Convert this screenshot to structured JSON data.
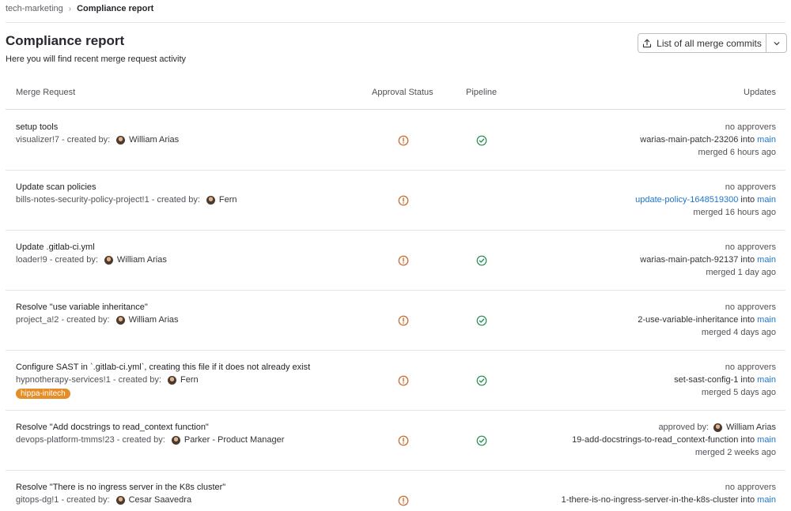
{
  "breadcrumb": {
    "group": "tech-marketing",
    "separator": "›",
    "current": "Compliance report"
  },
  "page": {
    "title": "Compliance report",
    "subtitle": "Here you will find recent merge request activity"
  },
  "export_button": {
    "label": "List of all merge commits",
    "icon": "export-icon",
    "caret_icon": "chevron-down-icon"
  },
  "table": {
    "headers": {
      "merge_request": "Merge Request",
      "approval_status": "Approval Status",
      "pipeline": "Pipeline",
      "updates": "Updates"
    },
    "rows": [
      {
        "title": "setup tools",
        "reference": "visualizer!7",
        "created_by_label": "- created by:",
        "author": "William Arias",
        "approval": "warning",
        "pipeline": "success",
        "approvers_text": "no approvers",
        "approver_name": "",
        "source_branch": "warias-main-patch-23206",
        "source_is_link": false,
        "into_label": "into",
        "target_branch": "main",
        "merged": "merged 6 hours ago",
        "label": ""
      },
      {
        "title": "Update scan policies",
        "reference": "bills-notes-security-policy-project!1",
        "created_by_label": "- created by:",
        "author": "Fern",
        "approval": "warning",
        "pipeline": "",
        "approvers_text": "no approvers",
        "approver_name": "",
        "source_branch": "update-policy-1648519300",
        "source_is_link": true,
        "into_label": "into",
        "target_branch": "main",
        "merged": "merged 16 hours ago",
        "label": ""
      },
      {
        "title": "Update .gitlab-ci.yml",
        "reference": "loader!9",
        "created_by_label": "- created by:",
        "author": "William Arias",
        "approval": "warning",
        "pipeline": "success",
        "approvers_text": "no approvers",
        "approver_name": "",
        "source_branch": "warias-main-patch-92137",
        "source_is_link": false,
        "into_label": "into",
        "target_branch": "main",
        "merged": "merged 1 day ago",
        "label": ""
      },
      {
        "title": "Resolve \"use variable inheritance\"",
        "reference": "project_a!2",
        "created_by_label": "- created by:",
        "author": "William Arias",
        "approval": "warning",
        "pipeline": "success",
        "approvers_text": "no approvers",
        "approver_name": "",
        "source_branch": "2-use-variable-inheritance",
        "source_is_link": false,
        "into_label": "into",
        "target_branch": "main",
        "merged": "merged 4 days ago",
        "label": ""
      },
      {
        "title": "Configure SAST in `.gitlab-ci.yml`, creating this file if it does not already exist",
        "reference": "hypnotherapy-services!1",
        "created_by_label": "- created by:",
        "author": "Fern",
        "approval": "warning",
        "pipeline": "success",
        "approvers_text": "no approvers",
        "approver_name": "",
        "source_branch": "set-sast-config-1",
        "source_is_link": false,
        "into_label": "into",
        "target_branch": "main",
        "merged": "merged 5 days ago",
        "label": "hippa-initech"
      },
      {
        "title": "Resolve \"Add docstrings to read_context function\"",
        "reference": "devops-platform-tmms!23",
        "created_by_label": "- created by:",
        "author": "Parker - Product Manager",
        "approval": "warning",
        "pipeline": "success",
        "approvers_text": "approved by:",
        "approver_name": "William Arias",
        "source_branch": "19-add-docstrings-to-read_context-function",
        "source_is_link": false,
        "into_label": "into",
        "target_branch": "main",
        "merged": "merged 2 weeks ago",
        "label": ""
      },
      {
        "title": "Resolve \"There is no ingress server in the K8s cluster\"",
        "reference": "gitops-dg!1",
        "created_by_label": "- created by:",
        "author": "Cesar Saavedra",
        "approval": "warning",
        "pipeline": "",
        "approvers_text": "no approvers",
        "approver_name": "",
        "source_branch": "1-there-is-no-ingress-server-in-the-k8s-cluster",
        "source_is_link": false,
        "into_label": "into",
        "target_branch": "main",
        "merged": "",
        "label": ""
      }
    ]
  },
  "colors": {
    "warning": "#c95d1a",
    "success": "#1f8b4c",
    "link": "#1f75cb",
    "badge": "#e58d27"
  }
}
